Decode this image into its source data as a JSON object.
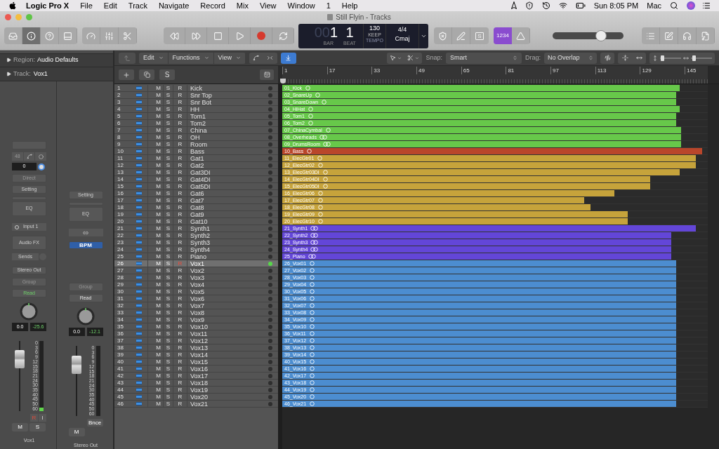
{
  "menu_bar": {
    "app": "Logic Pro X",
    "items": [
      "File",
      "Edit",
      "Track",
      "Navigate",
      "Record",
      "Mix",
      "View",
      "Window",
      "1",
      "Help"
    ],
    "clock": "Sun 8:05 PM",
    "user": "Mac"
  },
  "window": {
    "title": "Still Flyin - Tracks"
  },
  "toolbar": {
    "view_buttons": [
      {
        "kind": "library",
        "selected": false
      },
      {
        "kind": "inspector",
        "selected": true
      },
      {
        "kind": "help",
        "selected": false
      },
      {
        "kind": "editors",
        "selected": false
      }
    ],
    "lcd": {
      "bar_lead": "00",
      "bar": "1",
      "bar_label": "BAR",
      "beat": "1",
      "beat_label": "BEAT",
      "tempo": "130",
      "tempo_mode": "KEEP",
      "tempo_label": "TEMPO",
      "signature": "4/4",
      "key": "Cmaj"
    },
    "solo_mode": "S",
    "count_in": {
      "label": "1234",
      "selected": true
    },
    "master_volume": {
      "level": 0.68
    }
  },
  "inspector": {
    "region_label": "Region:",
    "region": "Audio Defaults",
    "track_label": "Track:",
    "track": "Vox1"
  },
  "strips": [
    {
      "kind": "channel",
      "format": "48",
      "gain": "0",
      "input_mode": "Direct",
      "setting": "Setting",
      "eq": "EQ",
      "input": "Input 1",
      "audio_fx": "Audio FX",
      "sends": "Sends",
      "output": "Stereo Out",
      "group": "Group",
      "automation": "Read",
      "automation_active": true,
      "volume": "0.0",
      "peak": "-25.6",
      "fader": {
        "level": 0.74
      },
      "meter": {
        "level": 0.05
      },
      "scale": [
        "0",
        "3",
        "6",
        "9",
        "12",
        "15",
        "18",
        "21",
        "24",
        "30",
        "35",
        "40",
        "45",
        "50",
        "60"
      ],
      "record": "R",
      "input_monitor": "I",
      "mute": "M",
      "solo": "S",
      "name": "Vox1"
    },
    {
      "kind": "output",
      "setting": "Setting",
      "eq": "EQ",
      "bpm": "BPM",
      "group": "Group",
      "automation": "Read",
      "automation_active": false,
      "volume": "0.0",
      "peak": "-12.1",
      "fader": {
        "level": 0.73
      },
      "scale": [
        "0",
        "3",
        "6",
        "9",
        "12",
        "15",
        "18",
        "21",
        "24",
        "30",
        "35",
        "40",
        "45",
        "50",
        "60"
      ],
      "bounce": "Bnce",
      "mute": "M",
      "name": "Stereo Out"
    }
  ],
  "arrange_toolbar": {
    "menus": [
      "Edit",
      "Functions",
      "View"
    ],
    "catch": {
      "selected": true
    },
    "snap_label": "Snap:",
    "snap": "Smart",
    "drag_label": "Drag:",
    "drag": "No Overlap",
    "vertical_zoom": {
      "level": 0.1
    },
    "horizontal_zoom": {
      "level": 0.15
    }
  },
  "track_header": {
    "solo_button": "S"
  },
  "ruler": {
    "bars": [
      "1",
      "17",
      "33",
      "49",
      "65",
      "81",
      "97",
      "113",
      "129",
      "145"
    ]
  },
  "tracks": [
    {
      "number": "1",
      "name": "Kick",
      "mute": "M",
      "solo": "S",
      "record": "R",
      "selected": false,
      "armed": false,
      "region": {
        "name": "01_Kick",
        "color": "#67c84a",
        "level": 0.934,
        "kind": "mono"
      }
    },
    {
      "number": "2",
      "name": "Snr Top",
      "mute": "M",
      "solo": "S",
      "record": "R",
      "selected": false,
      "armed": false,
      "region": {
        "name": "02_SnareUp",
        "color": "#67c84a",
        "level": 0.926,
        "kind": "mono"
      }
    },
    {
      "number": "3",
      "name": "Snr Bot",
      "mute": "M",
      "solo": "S",
      "record": "R",
      "selected": false,
      "armed": false,
      "region": {
        "name": "03_SnareDown",
        "color": "#67c84a",
        "level": 0.926,
        "kind": "mono"
      }
    },
    {
      "number": "4",
      "name": "HH",
      "mute": "M",
      "solo": "S",
      "record": "R",
      "selected": false,
      "armed": false,
      "region": {
        "name": "04_HiHat",
        "color": "#67c84a",
        "level": 0.934,
        "kind": "mono"
      }
    },
    {
      "number": "5",
      "name": "Tom1",
      "mute": "M",
      "solo": "S",
      "record": "R",
      "selected": false,
      "armed": false,
      "region": {
        "name": "05_Tom1",
        "color": "#67c84a",
        "level": 0.926,
        "kind": "mono"
      }
    },
    {
      "number": "6",
      "name": "Tom2",
      "mute": "M",
      "solo": "S",
      "record": "R",
      "selected": false,
      "armed": false,
      "region": {
        "name": "06_Tom2",
        "color": "#67c84a",
        "level": 0.926,
        "kind": "mono"
      }
    },
    {
      "number": "7",
      "name": "China",
      "mute": "M",
      "solo": "S",
      "record": "R",
      "selected": false,
      "armed": false,
      "region": {
        "name": "07_ChinaCymbal",
        "color": "#67c84a",
        "level": 0.937,
        "kind": "mono"
      }
    },
    {
      "number": "8",
      "name": "OH",
      "mute": "M",
      "solo": "S",
      "record": "R",
      "selected": false,
      "armed": false,
      "region": {
        "name": "08_Overheads",
        "color": "#67c84a",
        "level": 0.937,
        "kind": "stereo"
      }
    },
    {
      "number": "9",
      "name": "Room",
      "mute": "M",
      "solo": "S",
      "record": "R",
      "selected": false,
      "armed": false,
      "region": {
        "name": "09_DrumsRoom",
        "color": "#67c84a",
        "level": 0.937,
        "kind": "stereo"
      }
    },
    {
      "number": "10",
      "name": "Bass",
      "mute": "M",
      "solo": "S",
      "record": "R",
      "selected": false,
      "armed": false,
      "region": {
        "name": "10_Bass",
        "color": "#b9462b",
        "level": 0.987,
        "kind": "mono"
      }
    },
    {
      "number": "11",
      "name": "Gat1",
      "mute": "M",
      "solo": "S",
      "record": "R",
      "selected": false,
      "armed": false,
      "region": {
        "name": "11_ElecGtr01",
        "color": "#c6a33b",
        "level": 0.972,
        "kind": "mono"
      }
    },
    {
      "number": "12",
      "name": "Gat2",
      "mute": "M",
      "solo": "S",
      "record": "R",
      "selected": false,
      "armed": false,
      "region": {
        "name": "12_ElecGtr02",
        "color": "#c6a33b",
        "level": 0.972,
        "kind": "mono"
      }
    },
    {
      "number": "13",
      "name": "Gat3DI",
      "mute": "M",
      "solo": "S",
      "record": "R",
      "selected": false,
      "armed": false,
      "region": {
        "name": "13_ElecGtr03DI",
        "color": "#c6a33b",
        "level": 0.934,
        "kind": "mono"
      }
    },
    {
      "number": "14",
      "name": "Gat4DI",
      "mute": "M",
      "solo": "S",
      "record": "R",
      "selected": false,
      "armed": false,
      "region": {
        "name": "14_ElecGtr04DI",
        "color": "#c6a33b",
        "level": 0.865,
        "kind": "mono"
      }
    },
    {
      "number": "15",
      "name": "Gat5DI",
      "mute": "M",
      "solo": "S",
      "record": "R",
      "selected": false,
      "armed": false,
      "region": {
        "name": "15_ElecGtr05DI",
        "color": "#c6a33b",
        "level": 0.865,
        "kind": "mono"
      }
    },
    {
      "number": "16",
      "name": "Gat6",
      "mute": "M",
      "solo": "S",
      "record": "R",
      "selected": false,
      "armed": false,
      "region": {
        "name": "16_ElecGtr06",
        "color": "#c6a33b",
        "level": 0.781,
        "kind": "mono"
      }
    },
    {
      "number": "17",
      "name": "Gat7",
      "mute": "M",
      "solo": "S",
      "record": "R",
      "selected": false,
      "armed": false,
      "region": {
        "name": "17_ElecGtr07",
        "color": "#c6a33b",
        "level": 0.71,
        "kind": "mono"
      }
    },
    {
      "number": "18",
      "name": "Gat8",
      "mute": "M",
      "solo": "S",
      "record": "R",
      "selected": false,
      "armed": false,
      "region": {
        "name": "18_ElecGtr08",
        "color": "#c6a33b",
        "level": 0.724,
        "kind": "mono"
      }
    },
    {
      "number": "19",
      "name": "Gat9",
      "mute": "M",
      "solo": "S",
      "record": "R",
      "selected": false,
      "armed": false,
      "region": {
        "name": "19_ElecGtr09",
        "color": "#c6a33b",
        "level": 0.812,
        "kind": "mono"
      }
    },
    {
      "number": "20",
      "name": "Gat10",
      "mute": "M",
      "solo": "S",
      "record": "R",
      "selected": false,
      "armed": false,
      "region": {
        "name": "20_ElecGtr10",
        "color": "#c6a33b",
        "level": 0.812,
        "kind": "mono"
      }
    },
    {
      "number": "21",
      "name": "Synth1",
      "mute": "M",
      "solo": "S",
      "record": "R",
      "selected": false,
      "armed": false,
      "region": {
        "name": "21_Synth1",
        "color": "#6346d8",
        "level": 0.972,
        "kind": "stereo"
      }
    },
    {
      "number": "22",
      "name": "Synth2",
      "mute": "M",
      "solo": "S",
      "record": "R",
      "selected": false,
      "armed": false,
      "region": {
        "name": "22_Synth2",
        "color": "#6346d8",
        "level": 0.914,
        "kind": "stereo"
      }
    },
    {
      "number": "23",
      "name": "Synth3",
      "mute": "M",
      "solo": "S",
      "record": "R",
      "selected": false,
      "armed": false,
      "region": {
        "name": "23_Synth3",
        "color": "#6346d8",
        "level": 0.914,
        "kind": "stereo"
      }
    },
    {
      "number": "24",
      "name": "Synth4",
      "mute": "M",
      "solo": "S",
      "record": "R",
      "selected": false,
      "armed": false,
      "region": {
        "name": "24_Synth4",
        "color": "#6346d8",
        "level": 0.914,
        "kind": "stereo"
      }
    },
    {
      "number": "25",
      "name": "Piano",
      "mute": "M",
      "solo": "S",
      "record": "R",
      "selected": false,
      "armed": false,
      "region": {
        "name": "25_Piano",
        "color": "#6346d8",
        "level": 0.914,
        "kind": "stereo"
      }
    },
    {
      "number": "26",
      "name": "Vox1",
      "mute": "M",
      "solo": "S",
      "record": "R",
      "selected": true,
      "armed": true,
      "region": {
        "name": "26_Vox01",
        "color": "#4c8dd0",
        "level": 0.926,
        "kind": "mono"
      }
    },
    {
      "number": "27",
      "name": "Vox2",
      "mute": "M",
      "solo": "S",
      "record": "R",
      "selected": false,
      "armed": false,
      "region": {
        "name": "27_Vox02",
        "color": "#4c8dd0",
        "level": 0.926,
        "kind": "mono"
      }
    },
    {
      "number": "28",
      "name": "Vox3",
      "mute": "M",
      "solo": "S",
      "record": "R",
      "selected": false,
      "armed": false,
      "region": {
        "name": "28_Vox03",
        "color": "#4c8dd0",
        "level": 0.926,
        "kind": "mono"
      }
    },
    {
      "number": "29",
      "name": "Vox4",
      "mute": "M",
      "solo": "S",
      "record": "R",
      "selected": false,
      "armed": false,
      "region": {
        "name": "29_Vox04",
        "color": "#4c8dd0",
        "level": 0.926,
        "kind": "mono"
      }
    },
    {
      "number": "30",
      "name": "Vox5",
      "mute": "M",
      "solo": "S",
      "record": "R",
      "selected": false,
      "armed": false,
      "region": {
        "name": "30_Vox05",
        "color": "#4c8dd0",
        "level": 0.926,
        "kind": "mono"
      }
    },
    {
      "number": "31",
      "name": "Vox6",
      "mute": "M",
      "solo": "S",
      "record": "R",
      "selected": false,
      "armed": false,
      "region": {
        "name": "31_Vox06",
        "color": "#4c8dd0",
        "level": 0.926,
        "kind": "mono"
      }
    },
    {
      "number": "32",
      "name": "Vox7",
      "mute": "M",
      "solo": "S",
      "record": "R",
      "selected": false,
      "armed": false,
      "region": {
        "name": "32_Vox07",
        "color": "#4c8dd0",
        "level": 0.926,
        "kind": "mono"
      }
    },
    {
      "number": "33",
      "name": "Vox8",
      "mute": "M",
      "solo": "S",
      "record": "R",
      "selected": false,
      "armed": false,
      "region": {
        "name": "33_Vox08",
        "color": "#4c8dd0",
        "level": 0.926,
        "kind": "mono"
      }
    },
    {
      "number": "34",
      "name": "Vox9",
      "mute": "M",
      "solo": "S",
      "record": "R",
      "selected": false,
      "armed": false,
      "region": {
        "name": "34_Vox09",
        "color": "#4c8dd0",
        "level": 0.926,
        "kind": "mono"
      }
    },
    {
      "number": "35",
      "name": "Vox10",
      "mute": "M",
      "solo": "S",
      "record": "R",
      "selected": false,
      "armed": false,
      "region": {
        "name": "35_Vox10",
        "color": "#4c8dd0",
        "level": 0.926,
        "kind": "mono"
      }
    },
    {
      "number": "36",
      "name": "Vox11",
      "mute": "M",
      "solo": "S",
      "record": "R",
      "selected": false,
      "armed": false,
      "region": {
        "name": "36_Vox11",
        "color": "#4c8dd0",
        "level": 0.926,
        "kind": "mono"
      }
    },
    {
      "number": "37",
      "name": "Vox12",
      "mute": "M",
      "solo": "S",
      "record": "R",
      "selected": false,
      "armed": false,
      "region": {
        "name": "37_Vox12",
        "color": "#4c8dd0",
        "level": 0.926,
        "kind": "mono"
      }
    },
    {
      "number": "38",
      "name": "Vox13",
      "mute": "M",
      "solo": "S",
      "record": "R",
      "selected": false,
      "armed": false,
      "region": {
        "name": "38_Vox13",
        "color": "#4c8dd0",
        "level": 0.926,
        "kind": "mono"
      }
    },
    {
      "number": "39",
      "name": "Vox14",
      "mute": "M",
      "solo": "S",
      "record": "R",
      "selected": false,
      "armed": false,
      "region": {
        "name": "39_Vox14",
        "color": "#4c8dd0",
        "level": 0.926,
        "kind": "mono"
      }
    },
    {
      "number": "40",
      "name": "Vox15",
      "mute": "M",
      "solo": "S",
      "record": "R",
      "selected": false,
      "armed": false,
      "region": {
        "name": "40_Vox15",
        "color": "#4c8dd0",
        "level": 0.926,
        "kind": "mono"
      }
    },
    {
      "number": "41",
      "name": "Vox16",
      "mute": "M",
      "solo": "S",
      "record": "R",
      "selected": false,
      "armed": false,
      "region": {
        "name": "41_Vox16",
        "color": "#4c8dd0",
        "level": 0.926,
        "kind": "mono"
      }
    },
    {
      "number": "42",
      "name": "Vox17",
      "mute": "M",
      "solo": "S",
      "record": "R",
      "selected": false,
      "armed": false,
      "region": {
        "name": "42_Vox17",
        "color": "#4c8dd0",
        "level": 0.926,
        "kind": "mono"
      }
    },
    {
      "number": "43",
      "name": "Vox18",
      "mute": "M",
      "solo": "S",
      "record": "R",
      "selected": false,
      "armed": false,
      "region": {
        "name": "43_Vox18",
        "color": "#4c8dd0",
        "level": 0.926,
        "kind": "mono"
      }
    },
    {
      "number": "44",
      "name": "Vox19",
      "mute": "M",
      "solo": "S",
      "record": "R",
      "selected": false,
      "armed": false,
      "region": {
        "name": "44_Vox19",
        "color": "#4c8dd0",
        "level": 0.926,
        "kind": "mono"
      }
    },
    {
      "number": "45",
      "name": "Vox20",
      "mute": "M",
      "solo": "S",
      "record": "R",
      "selected": false,
      "armed": false,
      "region": {
        "name": "45_Vox20",
        "color": "#4c8dd0",
        "level": 0.926,
        "kind": "mono"
      }
    },
    {
      "number": "46",
      "name": "Vox21",
      "mute": "M",
      "solo": "S",
      "record": "R",
      "selected": false,
      "armed": false,
      "region": {
        "name": "46_Vox21",
        "color": "#4c8dd0",
        "level": 0.926,
        "kind": "mono"
      }
    }
  ]
}
